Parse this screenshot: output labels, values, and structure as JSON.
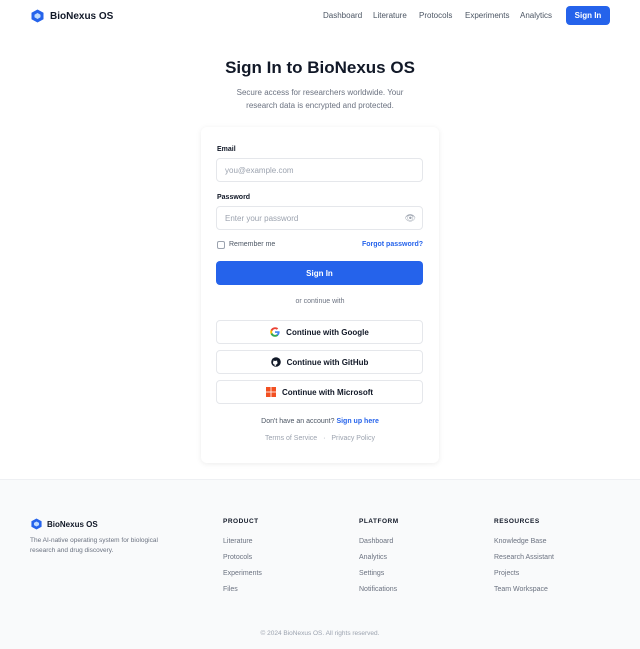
{
  "header": {
    "logo_text": "BioNexus OS",
    "nav": [
      "Dashboard",
      "Literature",
      "Protocols",
      "Experiments",
      "Analytics"
    ],
    "signin_label": "Sign In"
  },
  "hero": {
    "title": "Sign In to BioNexus OS",
    "subtitle": "Secure access for researchers worldwide. Your research data is encrypted and protected."
  },
  "form": {
    "email_label": "Email",
    "email_placeholder": "you@example.com",
    "password_label": "Password",
    "password_placeholder": "Enter your password",
    "eye_icon": "👁",
    "remember_label": "Remember me",
    "forgot_label": "Forgot password?",
    "submit_label": "Sign In",
    "divider_text": "or continue with",
    "social": [
      {
        "label": "Continue with Google",
        "icon": "google-icon"
      },
      {
        "label": "Continue with GitHub",
        "icon": "github-icon"
      },
      {
        "label": "Continue with Microsoft",
        "icon": "microsoft-icon"
      }
    ],
    "signup_prompt": "Don't have an account?",
    "signup_link": "Sign up here",
    "terms_label": "Terms of Service",
    "legal_separator": "·",
    "privacy_label": "Privacy Policy"
  },
  "footer": {
    "logo_text": "BioNexus OS",
    "description": "The AI-native operating system for biological research and drug discovery.",
    "columns": [
      {
        "heading": "PRODUCT",
        "links": [
          "Literature",
          "Protocols",
          "Experiments",
          "Files"
        ]
      },
      {
        "heading": "PLATFORM",
        "links": [
          "Dashboard",
          "Analytics",
          "Settings",
          "Notifications"
        ]
      },
      {
        "heading": "RESOURCES",
        "links": [
          "Knowledge Base",
          "Research Assistant",
          "Projects",
          "Team Workspace"
        ]
      }
    ],
    "copyright": "© 2024 BioNexus OS. All rights reserved."
  },
  "colors": {
    "accent": "#2563eb",
    "text": "#111827",
    "muted": "#6b7280"
  }
}
